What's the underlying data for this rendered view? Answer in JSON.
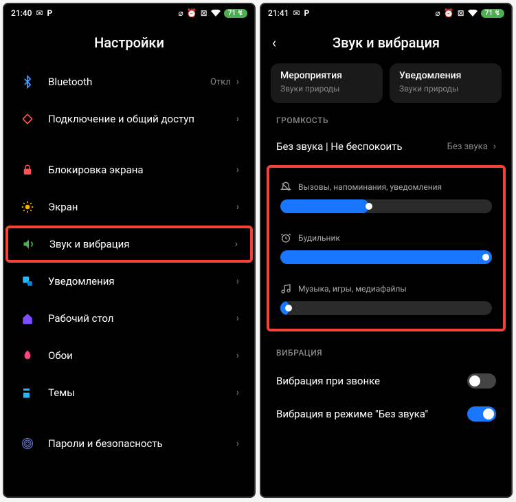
{
  "phone1": {
    "status": {
      "time": "21:40",
      "battery": "71"
    },
    "title": "Настройки",
    "items": [
      {
        "icon": "bluetooth",
        "label": "Bluetooth",
        "value": "Откл"
      },
      {
        "icon": "share",
        "label": "Подключение и общий доступ",
        "value": ""
      },
      {
        "sep": true
      },
      {
        "icon": "lock",
        "label": "Блокировка экрана",
        "value": ""
      },
      {
        "icon": "sun",
        "label": "Экран",
        "value": ""
      },
      {
        "icon": "sound",
        "label": "Звук и вибрация",
        "value": "",
        "highlight": true
      },
      {
        "icon": "bell",
        "label": "Уведомления",
        "value": ""
      },
      {
        "icon": "home",
        "label": "Рабочий стол",
        "value": ""
      },
      {
        "icon": "wallpaper",
        "label": "Обои",
        "value": ""
      },
      {
        "icon": "theme",
        "label": "Темы",
        "value": ""
      },
      {
        "sep": true
      },
      {
        "icon": "fingerprint",
        "label": "Пароли и безопасность",
        "value": ""
      }
    ]
  },
  "phone2": {
    "status": {
      "time": "21:41",
      "battery": "71"
    },
    "title": "Звук и вибрация",
    "cards": [
      {
        "title": "Мероприятия",
        "sub": "Звуки природы"
      },
      {
        "title": "Уведомления",
        "sub": "Звуки природы"
      }
    ],
    "volume": {
      "header": "ГРОМКОСТЬ",
      "silent": {
        "label": "Без звука | Не беспокоить",
        "value": "Без звука"
      },
      "sliders": [
        {
          "icon": "bell-off",
          "label": "Вызовы, напоминания, уведомления",
          "percent": 42
        },
        {
          "icon": "alarm",
          "label": "Будильник",
          "percent": 100
        },
        {
          "icon": "music",
          "label": "Музыка, игры, медиафайлы",
          "percent": 2
        }
      ]
    },
    "vibration": {
      "header": "ВИБРАЦИЯ",
      "toggles": [
        {
          "label": "Вибрация при звонке",
          "on": false
        },
        {
          "label": "Вибрация в режиме \"Без звука\"",
          "on": true
        }
      ]
    }
  }
}
